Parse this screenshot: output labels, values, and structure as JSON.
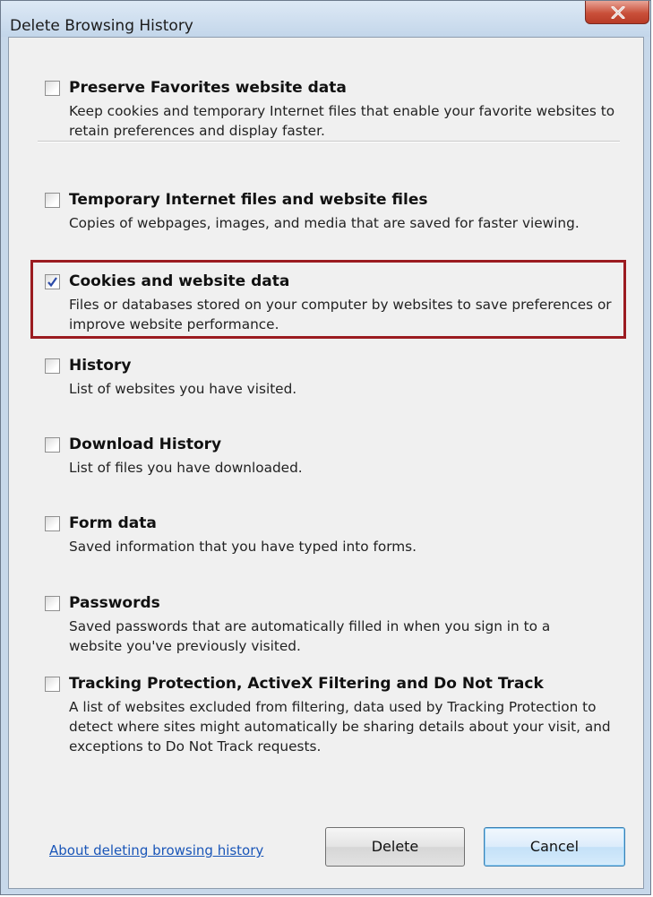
{
  "window": {
    "title": "Delete Browsing History"
  },
  "options": [
    {
      "label": "Preserve Favorites website data",
      "description": "Keep cookies and temporary Internet files that enable your favorite websites to retain preferences and display faster.",
      "checked": false
    },
    {
      "label": "Temporary Internet files and website files",
      "description": "Copies of webpages, images, and media that are saved for faster viewing.",
      "checked": false
    },
    {
      "label": "Cookies and website data",
      "description": "Files or databases stored on your computer by websites to save preferences or improve website performance.",
      "checked": true
    },
    {
      "label": "History",
      "description": "List of websites you have visited.",
      "checked": false
    },
    {
      "label": "Download History",
      "description": "List of files you have downloaded.",
      "checked": false
    },
    {
      "label": "Form data",
      "description": "Saved information that you have typed into forms.",
      "checked": false
    },
    {
      "label": "Passwords",
      "description": "Saved passwords that are automatically filled in when you sign in to a website you've previously visited.",
      "checked": false
    },
    {
      "label": "Tracking Protection, ActiveX Filtering and Do Not Track",
      "description": "A list of websites excluded from filtering, data used by Tracking Protection to detect where sites might automatically be sharing details about your visit, and exceptions to Do Not Track requests.",
      "checked": false
    }
  ],
  "footer": {
    "link_label": "About deleting browsing history",
    "delete_label": "Delete",
    "cancel_label": "Cancel"
  },
  "colors": {
    "highlight_border": "#9b1b20",
    "link": "#1a56b8"
  },
  "icons": {
    "close": "close-icon",
    "check": "checkmark-icon"
  }
}
